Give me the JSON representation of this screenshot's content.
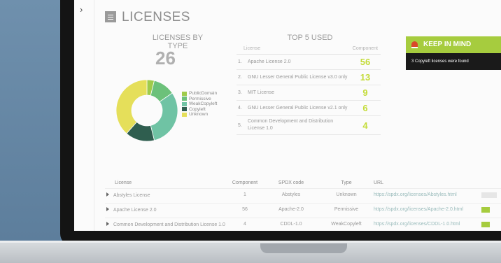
{
  "page_title": "LICENSES",
  "licenses_by_type": {
    "heading": "LICENSES BY TYPE",
    "total": "26",
    "legend": [
      {
        "label": "PublicDomain",
        "color": "#9fcb4a"
      },
      {
        "label": "Permissive",
        "color": "#6cc17a"
      },
      {
        "label": "WeakCopyleft",
        "color": "#6fc3a4"
      },
      {
        "label": "Copyleft",
        "color": "#2f5e4f"
      },
      {
        "label": "Unknown",
        "color": "#e5df5a"
      }
    ]
  },
  "chart_data": {
    "type": "pie",
    "donut": true,
    "categories": [
      "PublicDomain",
      "Permissive",
      "WeakCopyleft",
      "Copyleft",
      "Unknown"
    ],
    "values": [
      1,
      3,
      8,
      4,
      10
    ],
    "colors": [
      "#9fcb4a",
      "#6cc17a",
      "#6fc3a4",
      "#2f5e4f",
      "#e5df5a"
    ]
  },
  "top5": {
    "heading": "TOP 5 USED",
    "col_license": "License",
    "col_component": "Component",
    "rows": [
      {
        "num": "1.",
        "name": "Apache License 2.0",
        "count": "56"
      },
      {
        "num": "2.",
        "name": "GNU Lesser General Public License v3.0 only",
        "count": "13"
      },
      {
        "num": "3.",
        "name": "MIT License",
        "count": "9"
      },
      {
        "num": "4.",
        "name": "GNU Lesser General Public License v2.1 only",
        "count": "6"
      },
      {
        "num": "5.",
        "name": "Common Development and Distribution License 1.0",
        "count": "4"
      }
    ]
  },
  "keep_in_mind": {
    "title": "KEEP IN MIND",
    "message": "3 Copyleft licenses were found"
  },
  "table": {
    "headers": {
      "license": "License",
      "component": "Component",
      "spdx": "SPDX code",
      "type": "Type",
      "url": "URL"
    },
    "rows": [
      {
        "license": "Abstyles License",
        "component": "1",
        "spdx": "Abstyles",
        "type": "Unknown",
        "url": "https://spdx.org/licenses/Abstyles.html"
      },
      {
        "license": "Apache License 2.0",
        "component": "56",
        "spdx": "Apache-2.0",
        "type": "Permissive",
        "url": "https://spdx.org/licenses/Apache-2.0.html"
      },
      {
        "license": "Common Development and Distribution License 1.0",
        "component": "4",
        "spdx": "CDDL-1.0",
        "type": "WeakCopyleft",
        "url": "https://spdx.org/licenses/CDDL-1.0.html"
      }
    ]
  },
  "icons": [
    "sidebar-chevron-icon",
    "list-icon",
    "siren-icon",
    "expand-arrow-icon"
  ]
}
